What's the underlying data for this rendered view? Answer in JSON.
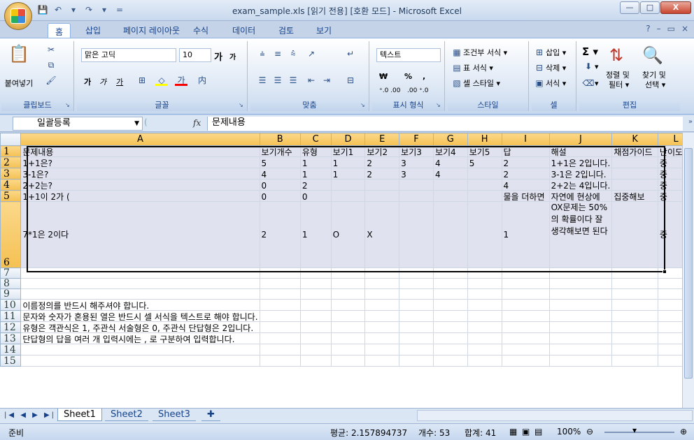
{
  "window": {
    "title": "exam_sample.xls  [읽기 전용]  [호환 모드]  -  Microsoft Excel",
    "controls": [
      "—",
      "□",
      "X"
    ]
  },
  "qat": [
    "💾",
    "↶",
    "▾",
    "↷",
    "▾",
    "="
  ],
  "tabs": [
    "홈",
    "삽입",
    "페이지 레이아웃",
    "수식",
    "데이터",
    "검토",
    "보기"
  ],
  "ribbon": {
    "clipboard": {
      "paste": "붙여넣기",
      "label": "클립보드"
    },
    "font": {
      "name": "맑은 고딕",
      "size": "10",
      "grow": "가",
      "shrink": "가",
      "bold": "가",
      "italic": "가",
      "underline": "가",
      "label": "글꼴"
    },
    "alignment": {
      "label": "맞춤"
    },
    "number": {
      "format": "텍스트",
      "currency": "₩",
      "percent": "%",
      "comma": ",",
      "inc": "⁺.0 .00",
      "dec": ".00 ⁺.0",
      "label": "표시 형식"
    },
    "styles": {
      "cond": "조건부 서식",
      "table": "표 서식",
      "cell": "셀 스타일",
      "label": "스타일"
    },
    "cells": {
      "insert": "삽입",
      "delete": "삭제",
      "format": "서식",
      "label": "셀"
    },
    "editing": {
      "sort": "정렬 및",
      "filter": "필터 ▾",
      "find": "찾기 및",
      "select": "선택 ▾",
      "label": "편집"
    }
  },
  "namebox": "일괄등록",
  "formula": "문제내용",
  "columns": [
    "A",
    "B",
    "C",
    "D",
    "E",
    "F",
    "G",
    "H",
    "I",
    "J",
    "K",
    "L"
  ],
  "rows": [
    [
      "문제내용",
      "보기개수",
      "유형",
      "보기1",
      "보기2",
      "보기3",
      "보기4",
      "보기5",
      "답",
      "해설",
      "채점가이드",
      "난이도"
    ],
    [
      "1+1은?",
      "5",
      "1",
      "1",
      "2",
      "3",
      "4",
      "5",
      "2",
      "1+1은 2입니다.",
      "",
      "중"
    ],
    [
      "3-1은?",
      "4",
      "1",
      "1",
      "2",
      "3",
      "4",
      "",
      "2",
      "3-1은 2입니다.",
      "",
      "중"
    ],
    [
      "2+2는?",
      "0",
      "2",
      "",
      "",
      "",
      "",
      "",
      "4",
      "2+2는 4입니다.",
      "",
      "중"
    ],
    [
      "1+1이 2가 (",
      "0",
      "0",
      "",
      "",
      "",
      "",
      "",
      "물을 더하면",
      "자연에 현상에",
      "집중해보",
      "중"
    ],
    [
      "7*1은 2이다",
      "2",
      "1",
      "O",
      "X",
      "",
      "",
      "",
      "1",
      "OX문제는 50%의 확률이다 잘생각해보면 된다",
      "",
      "중"
    ],
    [],
    [],
    [],
    [
      "이름정의를 반드시 해주셔야 합니다."
    ],
    [
      "문자와 숫자가 혼용된 열은 반드시 셀 서식을 텍스트로 해야 합니다."
    ],
    [
      "유형은 객관식은 1, 주관식 서술형은 0, 주관식 단답형은 2입니다."
    ],
    [
      "단답형의 답을 여러 개 입력시에는 , 로 구분하여 입력합니다."
    ],
    [],
    []
  ],
  "sheets": [
    "Sheet1",
    "Sheet2",
    "Sheet3"
  ],
  "status": {
    "mode": "준비",
    "average": "평균: 2.157894737",
    "count": "개수: 53",
    "sum": "합계: 41",
    "zoom": "100%"
  }
}
